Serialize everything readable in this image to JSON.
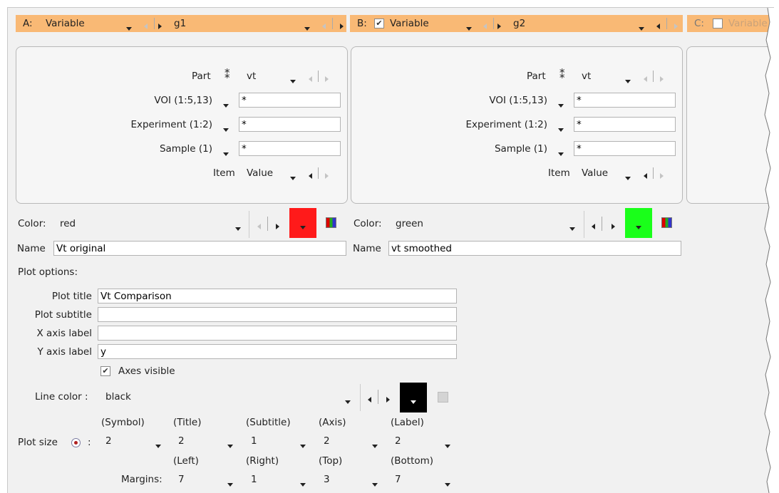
{
  "columns": [
    {
      "prefix": "A:",
      "checkbox": null,
      "type": "Variable",
      "group": "g1"
    },
    {
      "prefix": "B:",
      "checkbox": true,
      "type": "Variable",
      "group": "g2"
    },
    {
      "prefix": "C:",
      "checkbox": false,
      "type": "Variable"
    }
  ],
  "panels": [
    {
      "part_label": "Part",
      "part_value": "vt",
      "voi_label": "VOI (1:5,13)",
      "voi_value": "*",
      "experiment_label": "Experiment (1:2)",
      "experiment_value": "*",
      "sample_label": "Sample (1)",
      "sample_value": "*",
      "item_label": "Item",
      "item_value": "Value"
    },
    {
      "part_label": "Part",
      "part_value": "vt",
      "voi_label": "VOI (1:5,13)",
      "voi_value": "*",
      "experiment_label": "Experiment (1:2)",
      "experiment_value": "*",
      "sample_label": "Sample (1)",
      "sample_value": "*",
      "item_label": "Item",
      "item_value": "Value"
    }
  ],
  "series": [
    {
      "color_label": "Color:",
      "color_name": "red",
      "swatch": "#ff1a1a",
      "name_label": "Name",
      "name_value": "Vt original"
    },
    {
      "color_label": "Color:",
      "color_name": "green",
      "swatch": "#1aff1a",
      "name_label": "Name",
      "name_value": "vt smoothed"
    }
  ],
  "plot_options": {
    "header": "Plot options:",
    "plot_title_label": "Plot title",
    "plot_title_value": "Vt Comparison",
    "plot_subtitle_label": "Plot subtitle",
    "plot_subtitle_value": "",
    "x_axis_label": "X axis label",
    "x_axis_value": "",
    "y_axis_label": "Y axis label",
    "y_axis_value": "y",
    "axes_visible_label": "Axes visible",
    "axes_visible": true,
    "line_color_label": "Line color :",
    "line_color_value": "black",
    "line_color_swatch": "#000000",
    "plot_size_label": "Plot size",
    "size_headers": [
      "(Symbol)",
      "(Title)",
      "(Subtitle)",
      "(Axis)",
      "(Label)"
    ],
    "size_values": [
      "2",
      "2",
      "1",
      "2",
      "2"
    ],
    "margins_label": "Margins:",
    "margin_headers": [
      "(Left)",
      "(Right)",
      "(Top)",
      "(Bottom)"
    ],
    "margin_values": [
      "7",
      "1",
      "3",
      "7"
    ]
  }
}
